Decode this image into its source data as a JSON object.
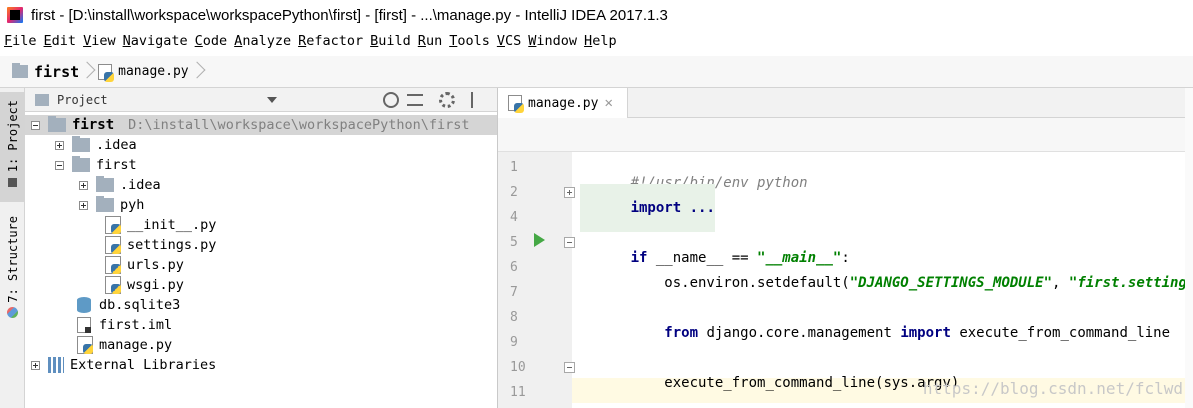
{
  "window": {
    "title": "first - [D:\\install\\workspace\\workspacePython\\first] - [first] - ...\\manage.py - IntelliJ IDEA 2017.1.3"
  },
  "menu": [
    "File",
    "Edit",
    "View",
    "Navigate",
    "Code",
    "Analyze",
    "Refactor",
    "Build",
    "Run",
    "Tools",
    "VCS",
    "Window",
    "Help"
  ],
  "breadcrumb": {
    "project": "first",
    "file": "manage.py"
  },
  "left_strip": {
    "project_tab": "1: Project",
    "structure_tab": "7: Structure"
  },
  "project_panel": {
    "header": "Project"
  },
  "tree": {
    "root": {
      "name": "first",
      "path": "D:\\install\\workspace\\workspacePython\\first"
    },
    "idea": ".idea",
    "first_pkg": "first",
    "first_idea": ".idea",
    "pyh": "pyh",
    "init": "__init__.py",
    "settings": "settings.py",
    "urls": "urls.py",
    "wsgi": "wsgi.py",
    "db": "db.sqlite3",
    "iml": "first.iml",
    "manage": "manage.py",
    "ext_libs": "External Libraries"
  },
  "editor": {
    "tab_label": "manage.py",
    "lines": {
      "l1": "#!/usr/bin/env python",
      "l2_kw": "import",
      "l2_rest": " ...",
      "l5_if": "if",
      "l5_mid": " __name__ == ",
      "l5_str": "\"__main__\"",
      "l5_end": ":",
      "l6_pre": "    os.environ.setdefault(",
      "l6_s1": "\"DJANGO_SETTINGS_MODULE\"",
      "l6_mid": ", ",
      "l6_s2": "\"first.settings\"",
      "l6_end": ")",
      "l8_from": "from",
      "l8_mid": " django.core.management ",
      "l8_import": "import",
      "l8_end": " execute_from_command_line",
      "l10": "    execute_from_command_line(sys.argv)"
    },
    "line_numbers": [
      "1",
      "2",
      "4",
      "5",
      "6",
      "7",
      "8",
      "9",
      "10",
      "11"
    ]
  },
  "watermark": "https://blog.csdn.net/fclwd"
}
